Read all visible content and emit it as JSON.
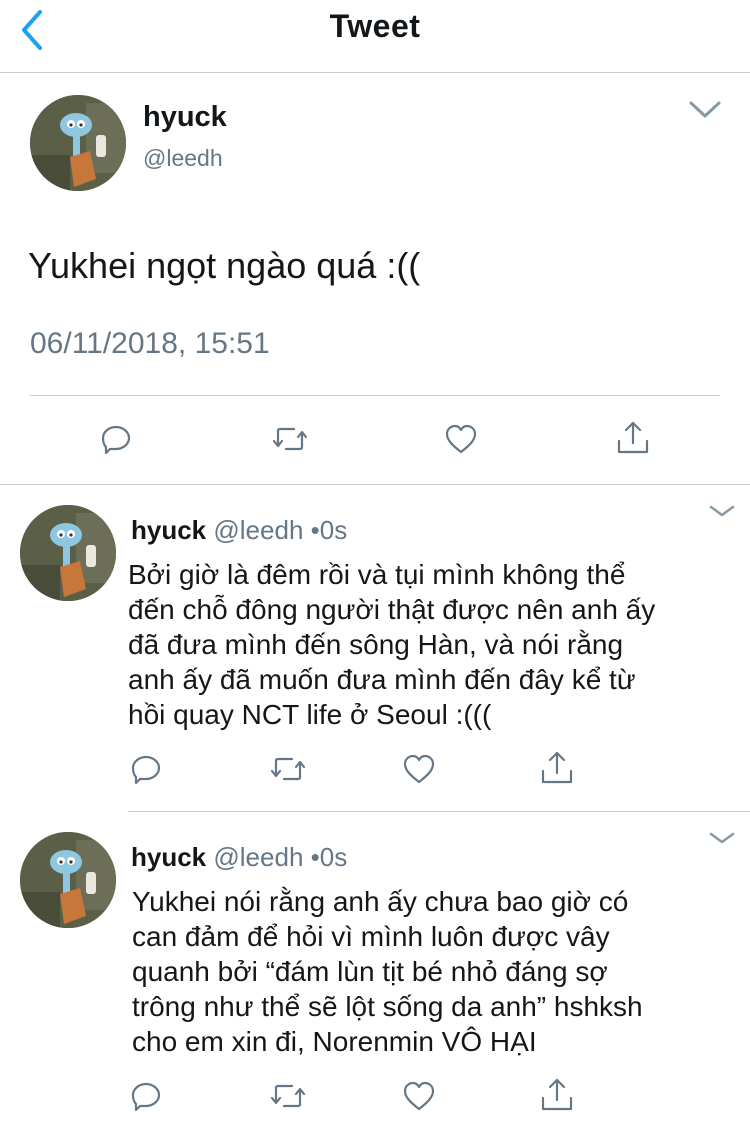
{
  "header": {
    "title": "Tweet",
    "back_icon": "chevron-left-icon",
    "accent": "#1da1f2"
  },
  "main_tweet": {
    "name": "hyuck",
    "handle": "@leedh",
    "text": "Yukhei ngọt ngào quá :((",
    "timestamp": "06/11/2018, 15:51",
    "actions": [
      "reply-icon",
      "retweet-icon",
      "like-icon",
      "share-icon"
    ]
  },
  "replies": [
    {
      "name": "hyuck",
      "handle": "@leedh",
      "separator": "•",
      "time": "0s",
      "text": "Bởi giờ là đêm rồi và tụi mình không thể\nđến chỗ đông người thật được nên anh ấy\nđã đưa mình đến sông Hàn, và nói rằng\nanh ấy đã muốn đưa mình đến đây kể từ\nhồi quay NCT life ở Seoul :((("
    },
    {
      "name": "hyuck",
      "handle": "@leedh",
      "separator": "•",
      "time": "0s",
      "text": "Yukhei nói rằng anh ấy chưa bao giờ có\ncan đảm để hỏi vì mình luôn được vây\nquanh bởi “đám lùn tịt bé nhỏ đáng sợ\ntrông như thể sẽ lột sống da anh” hshksh\ncho em xin đi, Norenmin VÔ HẠI"
    }
  ]
}
